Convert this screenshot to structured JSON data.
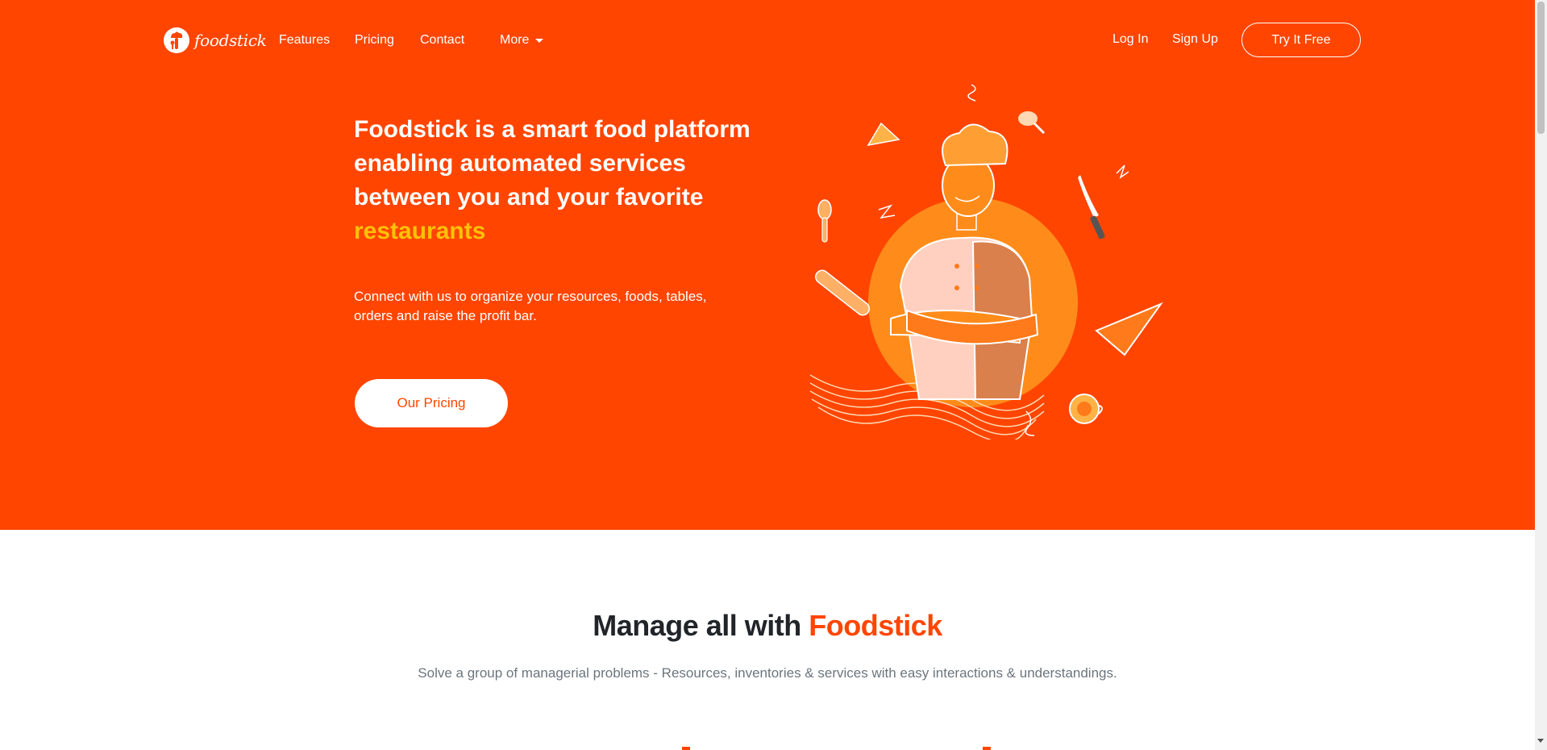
{
  "brand": {
    "logo_text": "foodstick",
    "logo_icon": "chef-hat-icon"
  },
  "nav": {
    "links": [
      "Features",
      "Pricing",
      "Contact"
    ],
    "more_label": "More",
    "login_label": "Log In",
    "signup_label": "Sign Up",
    "try_label": "Try It Free"
  },
  "hero": {
    "title": "Foodstick is a smart food platform enabling automated services between you and your favorite ",
    "title_accent": "restaurants",
    "subtitle": "Connect with us to organize your resources, foods, tables, orders and raise the profit bar.",
    "cta_label": "Our Pricing",
    "illustration": "chef-illustration"
  },
  "section": {
    "title_prefix": "Manage all with ",
    "title_brand": "Foodstick",
    "subtitle": "Solve a group of managerial problems - Resources, inventories & services with easy interactions & understandings."
  },
  "colors": {
    "primary": "#ff4500",
    "accent": "#ffc107",
    "heading": "#212529",
    "muted": "#6c757d"
  }
}
